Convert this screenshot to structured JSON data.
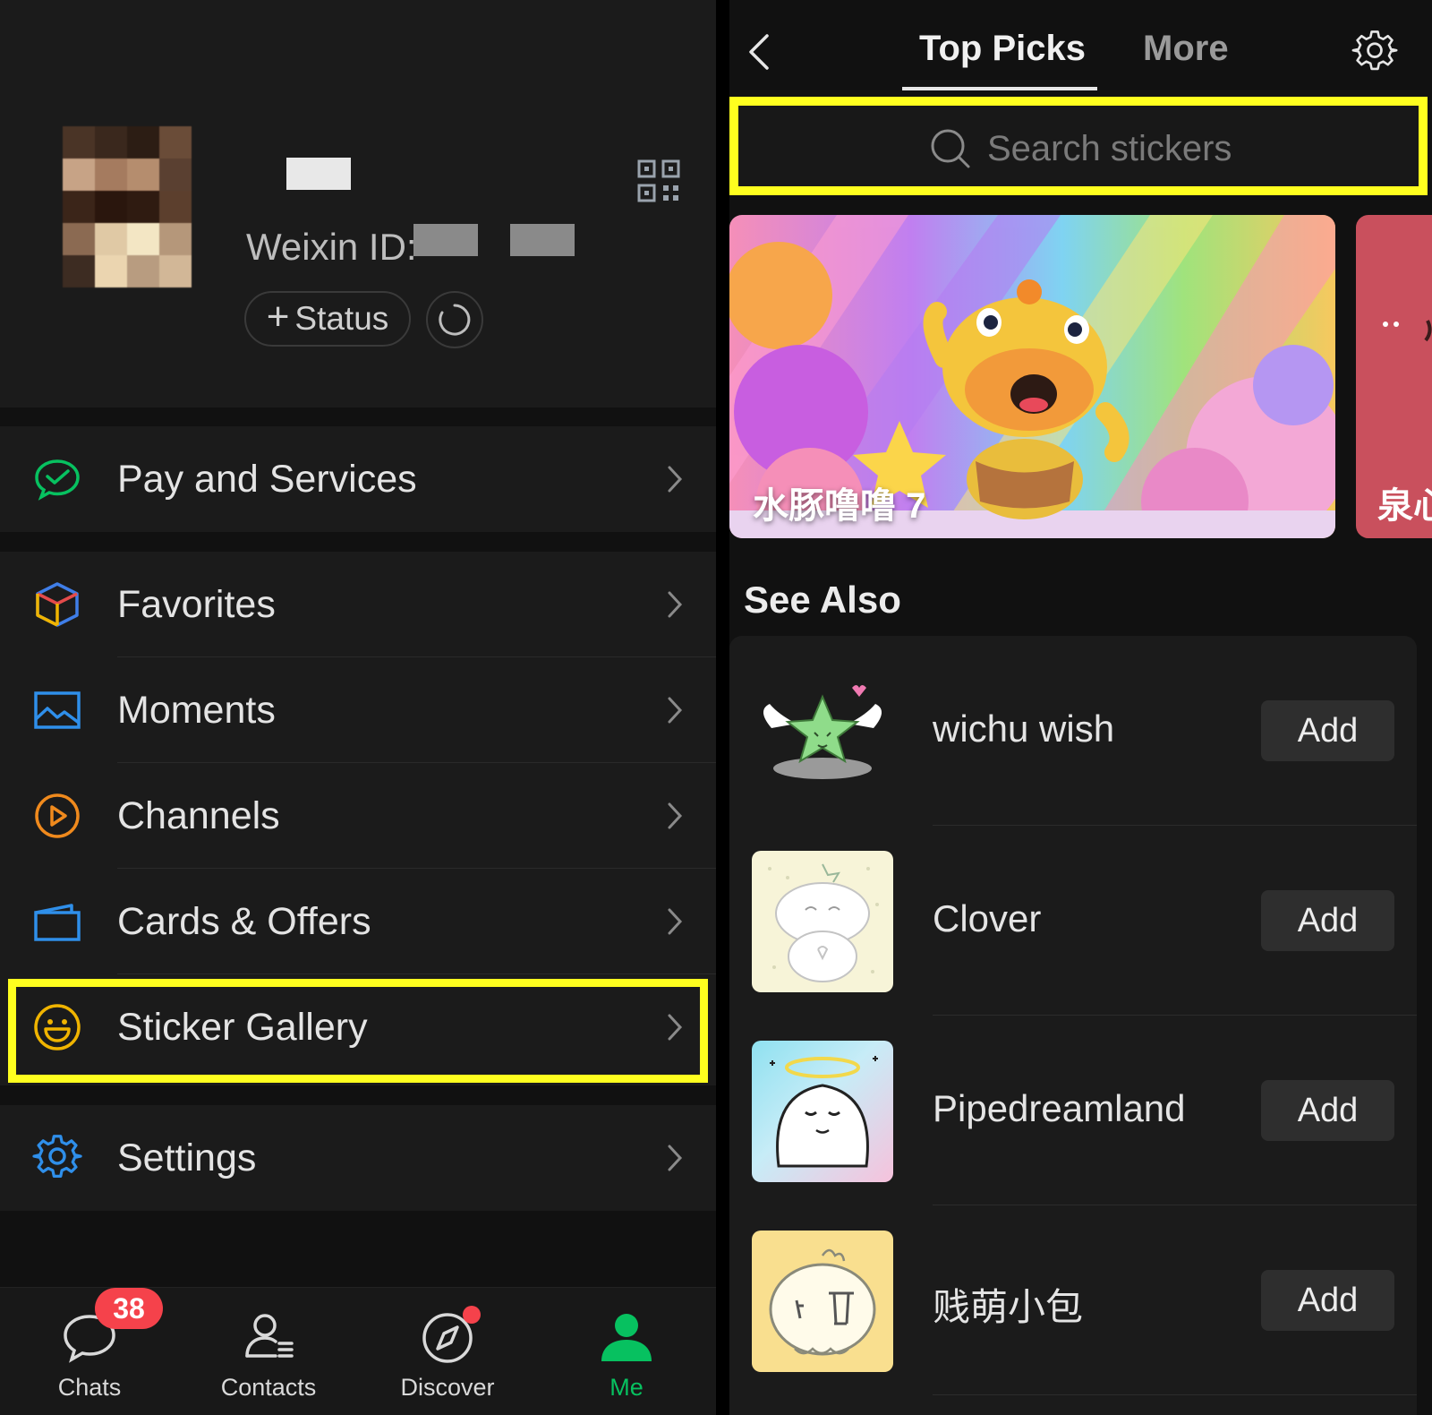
{
  "profile": {
    "weixin_id_label": "Weixin ID:",
    "status_label": "Status"
  },
  "menu": {
    "pay": "Pay and Services",
    "favorites": "Favorites",
    "moments": "Moments",
    "channels": "Channels",
    "cards": "Cards & Offers",
    "stickers": "Sticker Gallery",
    "settings": "Settings"
  },
  "tabbar": {
    "chats": "Chats",
    "chats_badge": "38",
    "contacts": "Contacts",
    "discover": "Discover",
    "me": "Me"
  },
  "sticker_store": {
    "tab_top": "Top Picks",
    "tab_more": "More",
    "search_placeholder": "Search stickers",
    "banner1_title": "水豚噜噜 7",
    "banner2_title": "泉心",
    "see_also": "See Also",
    "add_label": "Add",
    "items": [
      {
        "name": "wichu wish"
      },
      {
        "name": "Clover"
      },
      {
        "name": "Pipedreamland"
      },
      {
        "name": "贱萌小包"
      }
    ]
  },
  "colors": {
    "accent_green": "#07c160",
    "highlight_yellow": "#ffff1f",
    "badge_red": "#f5424b"
  }
}
